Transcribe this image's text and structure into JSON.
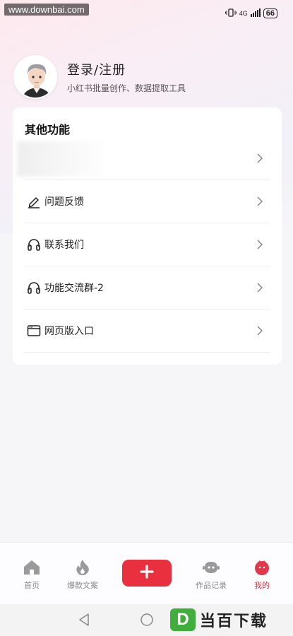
{
  "status_bar": {
    "watermark": "www.downbai.com",
    "network": "4G",
    "battery": "66"
  },
  "profile": {
    "title": "登录/注册",
    "subtitle": "小红书批量创作、数据提取工具"
  },
  "card": {
    "title": "其他功能",
    "items": [
      {
        "label": "",
        "icon": "blurred-icon"
      },
      {
        "label": "问题反馈",
        "icon": "pencil-icon"
      },
      {
        "label": "联系我们",
        "icon": "headset-icon"
      },
      {
        "label": "功能交流群-2",
        "icon": "headset-icon"
      },
      {
        "label": "网页版入口",
        "icon": "browser-window-icon"
      }
    ]
  },
  "tabbar": {
    "tabs": [
      {
        "label": "首页",
        "icon": "home-icon"
      },
      {
        "label": "爆款文案",
        "icon": "flame-icon"
      },
      {
        "label": "",
        "icon": "plus-icon"
      },
      {
        "label": "作品记录",
        "icon": "robot-face-icon"
      },
      {
        "label": "我的",
        "icon": "user-face-icon",
        "active": true
      }
    ],
    "accent_color": "#e8303e"
  },
  "brand": {
    "badge": "D",
    "text": "当百下载"
  }
}
